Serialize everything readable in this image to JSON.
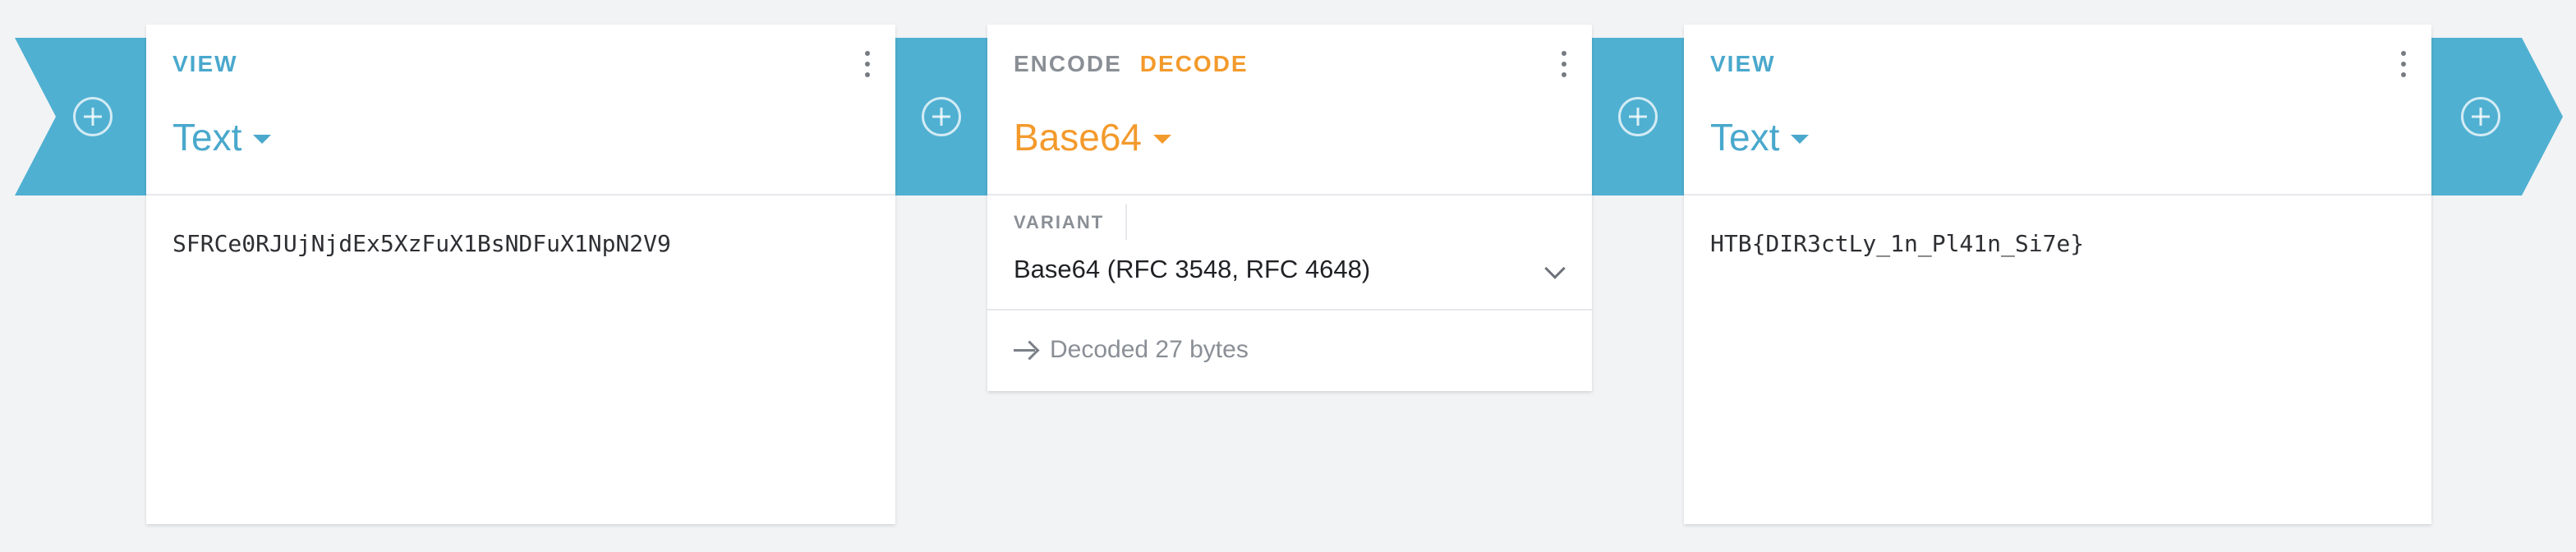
{
  "colors": {
    "accent_blue": "#4aa8cc",
    "accent_orange": "#f39a2c",
    "connector_blue": "#4fb0d2",
    "background": "#f2f3f5"
  },
  "connectors": [
    {
      "icon": "add-circle-icon"
    },
    {
      "icon": "add-circle-icon"
    },
    {
      "icon": "add-circle-icon"
    },
    {
      "icon": "add-circle-icon"
    }
  ],
  "input_card": {
    "tab": "VIEW",
    "format": "Text",
    "content": "SFRCe0RJUjNjdEx5XzFuX1BsNDFuX1NpN2V9",
    "menu_icon": "more-vert-icon"
  },
  "operation_card": {
    "tabs": [
      "ENCODE",
      "DECODE"
    ],
    "active_tab": "DECODE",
    "operation": "Base64",
    "variant_label": "VARIANT",
    "variant_value": "Base64 (RFC 3548, RFC 4648)",
    "status": "Decoded 27 bytes",
    "menu_icon": "more-vert-icon"
  },
  "output_card": {
    "tab": "VIEW",
    "format": "Text",
    "content": "HTB{DIR3ctLy_1n_Pl41n_Si7e}",
    "menu_icon": "more-vert-icon"
  }
}
